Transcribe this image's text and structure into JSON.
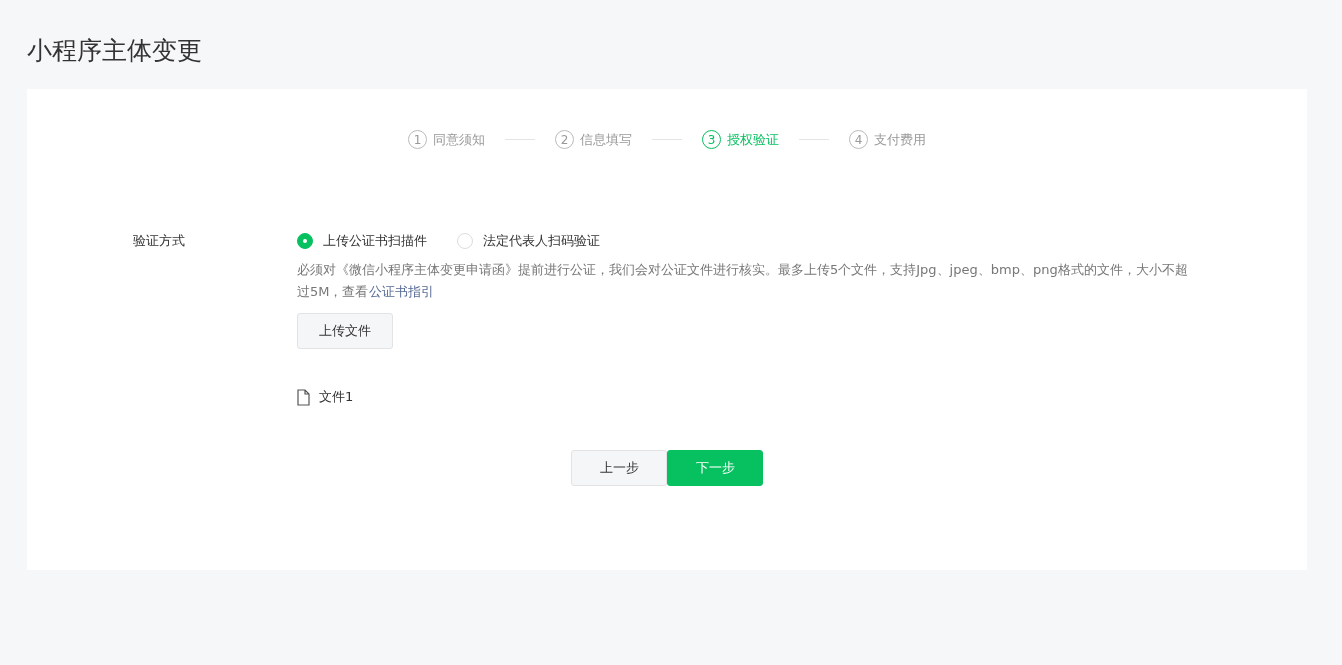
{
  "page_title": "小程序主体变更",
  "steps": [
    {
      "number": "1",
      "label": "同意须知",
      "selected": false
    },
    {
      "number": "2",
      "label": "信息填写",
      "selected": false
    },
    {
      "number": "3",
      "label": "授权验证",
      "selected": true
    },
    {
      "number": "4",
      "label": "支付费用",
      "selected": false
    }
  ],
  "form": {
    "label": "验证方式",
    "options": [
      {
        "label": "上传公证书扫描件",
        "selected": true
      },
      {
        "label": "法定代表人扫码验证",
        "selected": false
      }
    ],
    "description": "必须对《微信小程序主体变更申请函》提前进行公证，我们会对公证文件进行核实。最多上传5个文件，支持Jpg、jpeg、bmp、png格式的文件，大小不超过5M，查看",
    "description_link": "公证书指引",
    "upload_button": "上传文件",
    "files": [
      "文件1"
    ]
  },
  "buttons": {
    "previous": "上一步",
    "next": "下一步"
  }
}
